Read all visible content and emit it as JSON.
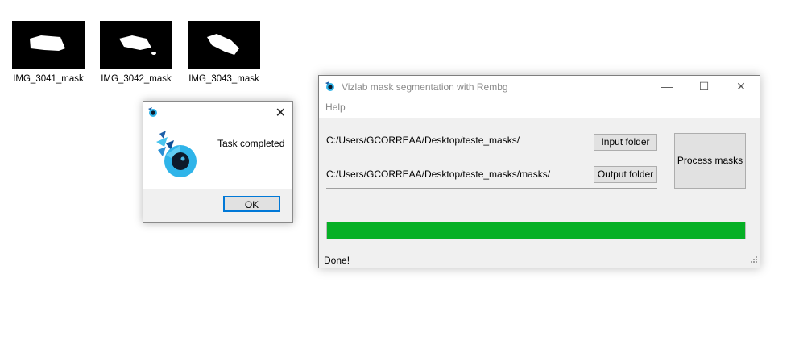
{
  "desktop": {
    "icons": [
      {
        "label": "IMG_3041_mask"
      },
      {
        "label": "IMG_3042_mask"
      },
      {
        "label": "IMG_3043_mask"
      }
    ]
  },
  "dialog": {
    "message": "Task completed",
    "ok_label": "OK",
    "close_glyph": "✕"
  },
  "app": {
    "title": "Vizlab mask segmentation with Rembg",
    "menu": {
      "help": "Help"
    },
    "window_controls": {
      "minimize": "—",
      "maximize": "☐",
      "close": "✕"
    },
    "input_path": "C:/Users/GCORREAA/Desktop/teste_masks/",
    "output_path": "C:/Users/GCORREAA/Desktop/teste_masks/masks/",
    "input_button": "Input folder",
    "output_button": "Output folder",
    "process_button": "Process masks",
    "progress_fraction": 1.0,
    "progress_color": "#06b025",
    "status": "Done!"
  },
  "icons": {
    "app": "eye-logo-icon",
    "grip": "resize-grip-icon"
  }
}
